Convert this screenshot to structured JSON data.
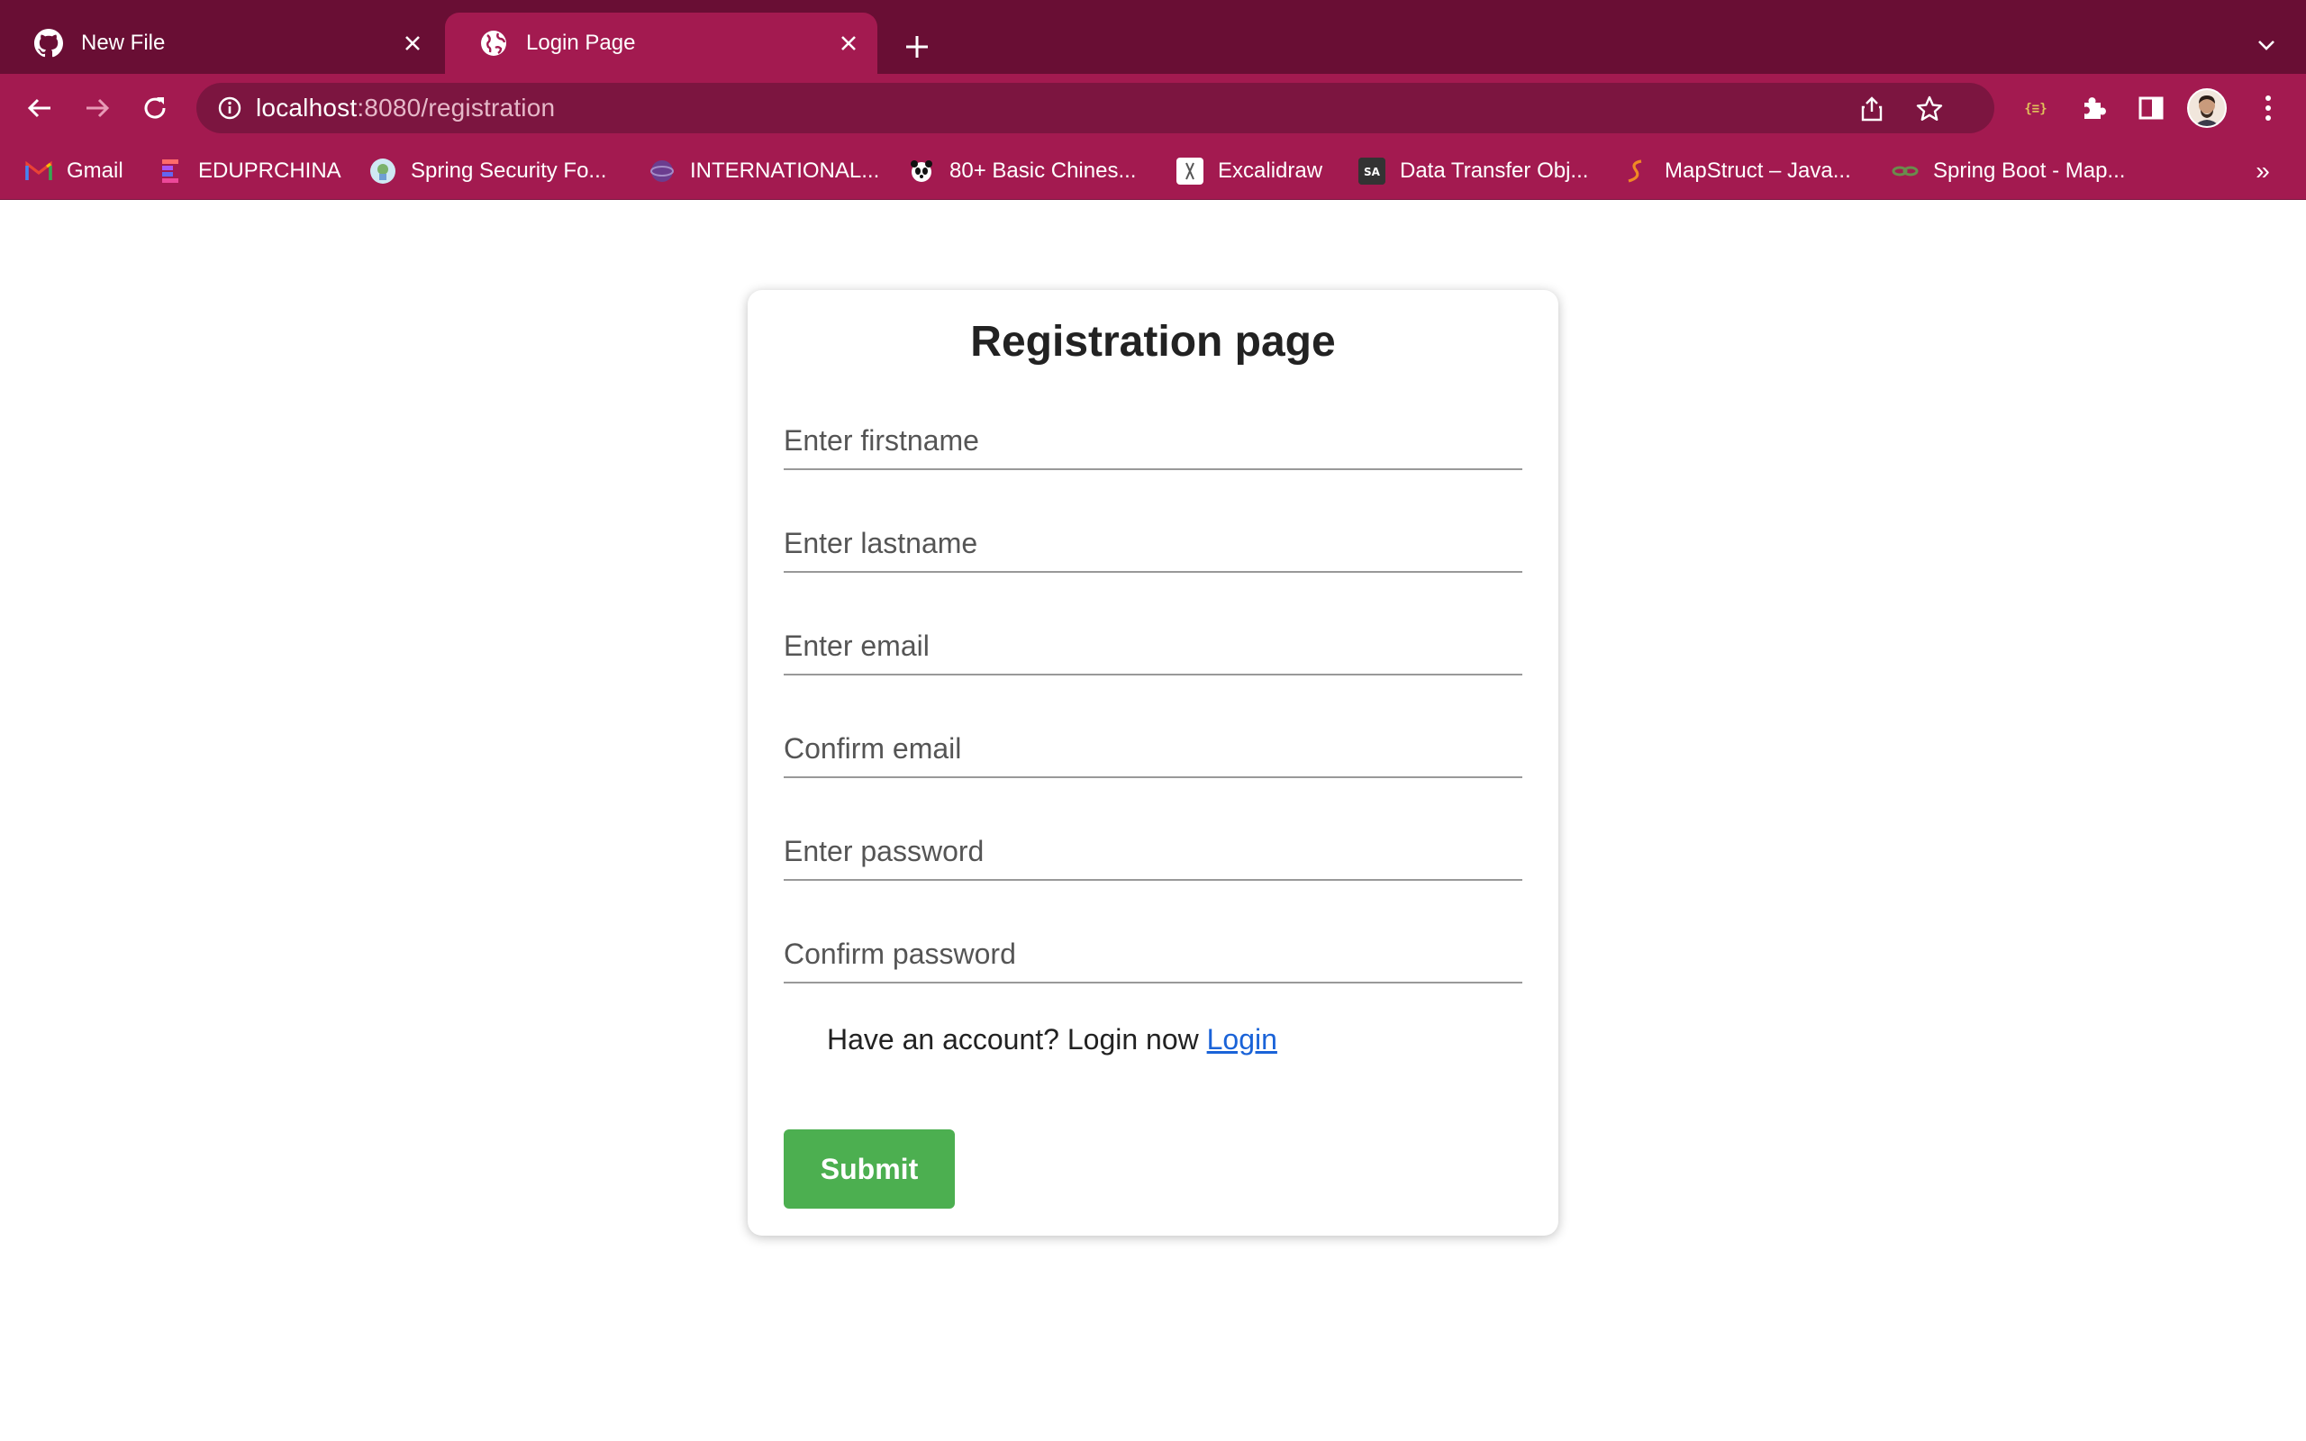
{
  "browser": {
    "tabs": [
      {
        "title": "New File",
        "icon": "github-icon",
        "active": false
      },
      {
        "title": "Login Page",
        "icon": "globe-icon",
        "active": true
      }
    ],
    "url_host": "localhost",
    "url_path": ":8080/registration",
    "bookmarks": [
      {
        "label": "Gmail",
        "icon": "gmail-icon"
      },
      {
        "label": "EDUPRCHINA",
        "icon": "eduprchina-icon"
      },
      {
        "label": "Spring Security Fo...",
        "icon": "spring-security-icon"
      },
      {
        "label": "INTERNATIONAL...",
        "icon": "international-icon"
      },
      {
        "label": "80+ Basic Chines...",
        "icon": "panda-icon"
      },
      {
        "label": "Excalidraw",
        "icon": "excalidraw-icon"
      },
      {
        "label": "Data Transfer Obj...",
        "icon": "sa-icon"
      },
      {
        "label": "MapStruct – Java...",
        "icon": "mapstruct-icon"
      },
      {
        "label": "Spring Boot - Map...",
        "icon": "springboot-icon"
      }
    ],
    "bookmarks_overflow": "»",
    "theme_colors": {
      "tabstrip": "#690e34",
      "toolbar": "#a31a50",
      "omnibox": "#7c1540"
    }
  },
  "page": {
    "title": "Registration page",
    "fields": [
      {
        "placeholder": "Enter firstname",
        "value": ""
      },
      {
        "placeholder": "Enter lastname",
        "value": ""
      },
      {
        "placeholder": "Enter email",
        "value": ""
      },
      {
        "placeholder": "Confirm email",
        "value": ""
      },
      {
        "placeholder": "Enter password",
        "value": ""
      },
      {
        "placeholder": "Confirm password",
        "value": ""
      }
    ],
    "login_prompt": "Have an account? Login now ",
    "login_link": "Login",
    "submit_label": "Submit",
    "accent_color": "#4caf50",
    "link_color": "#1a63d8"
  }
}
